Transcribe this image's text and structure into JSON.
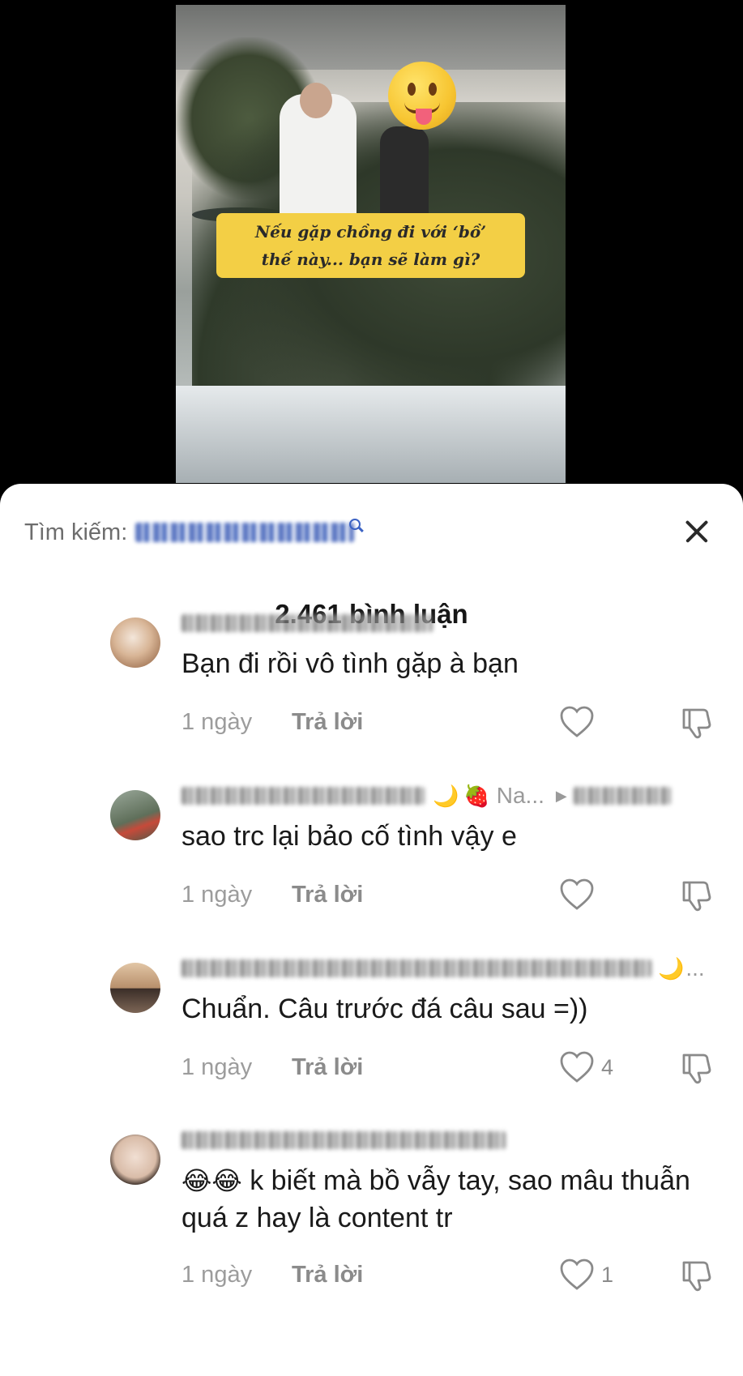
{
  "video": {
    "caption_line1": "Nếu gặp chồng đi với ‘bồ’",
    "caption_line2": "thế này... bạn sẽ làm gì?"
  },
  "sheet": {
    "search_label": "Tìm kiếm:",
    "comment_count": "2.461 bình luận"
  },
  "comments": [
    {
      "text": "Bạn đi rồi vô tình gặp à bạn",
      "time": "1 ngày",
      "reply": "Trả lời",
      "likes": "",
      "name_extra": "",
      "avatar_colors": [
        "#e9d9c9",
        "#b37c52"
      ]
    },
    {
      "text": "sao trc lại bảo cố tình vậy e",
      "time": "1 ngày",
      "reply": "Trả lời",
      "likes": "",
      "name_extra": "Na...",
      "avatar_colors": [
        "#7d8d78",
        "#3f4a3c"
      ]
    },
    {
      "text": "Chuẩn. Câu trước đá câu sau =))",
      "time": "1 ngày",
      "reply": "Trả lời",
      "likes": "4",
      "name_extra": "...",
      "avatar_colors": [
        "#cfa987",
        "#5a3f2c"
      ]
    },
    {
      "text": "k biết mà bồ vẫy tay, sao mâu thuẫn quá z hay là content tr",
      "time": "1 ngày",
      "reply": "Trả lời",
      "likes": "1",
      "name_extra": "",
      "avatar_colors": [
        "#e8d4c6",
        "#5b4a40"
      ]
    }
  ]
}
